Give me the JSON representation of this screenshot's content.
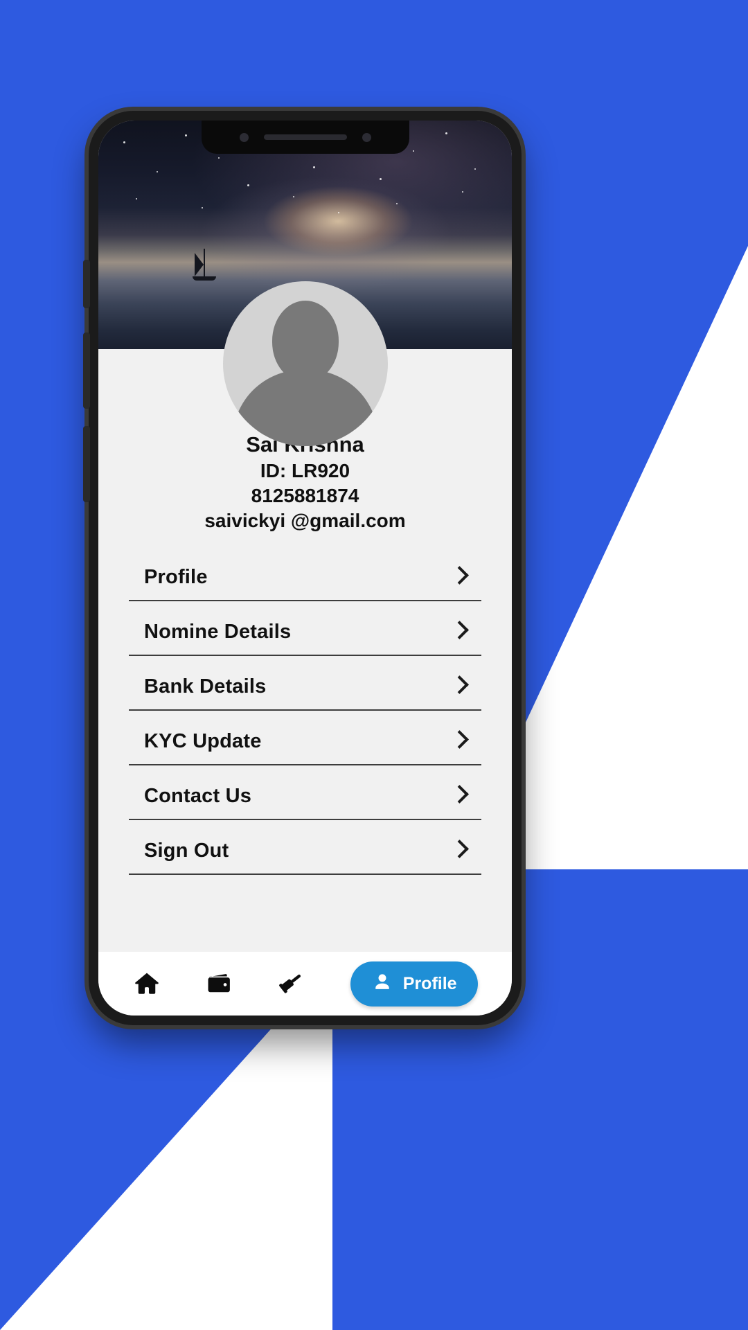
{
  "theme": {
    "page_background": "#2e5ae0",
    "wedge_color": "#ffffff",
    "screen_background": "#f1f1f1",
    "accent_blue": "#1f8fd6",
    "text_color": "#101010",
    "divider_color": "#3d3d3d"
  },
  "profile": {
    "name": "Sai Krishna",
    "id_line": "ID:  LR920",
    "phone": "8125881874",
    "email": "saivickyi @gmail.com",
    "avatar_icon": "person-placeholder-icon"
  },
  "menu": {
    "items": [
      {
        "label": "Profile",
        "icon": "chevron-right-icon"
      },
      {
        "label": "Nomine Details",
        "icon": "chevron-right-icon"
      },
      {
        "label": "Bank Details",
        "icon": "chevron-right-icon"
      },
      {
        "label": "KYC Update",
        "icon": "chevron-right-icon"
      },
      {
        "label": "Contact Us",
        "icon": "chevron-right-icon"
      },
      {
        "label": "Sign Out",
        "icon": "chevron-right-icon"
      }
    ]
  },
  "bottom_nav": {
    "items": [
      {
        "icon": "home-icon",
        "label": "",
        "active": false
      },
      {
        "icon": "wallet-icon",
        "label": "",
        "active": false
      },
      {
        "icon": "gavel-icon",
        "label": "",
        "active": false
      },
      {
        "icon": "person-icon",
        "label": "Profile",
        "active": true
      }
    ]
  },
  "device": {
    "notch": {
      "camera_icon": "camera-dot-icon",
      "speaker_icon": "speaker-grill-icon"
    }
  }
}
